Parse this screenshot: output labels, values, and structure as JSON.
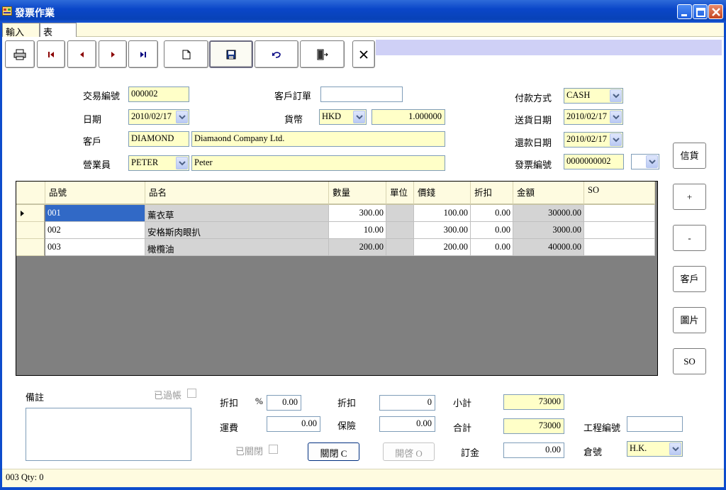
{
  "window": {
    "title": "發票作業"
  },
  "tabs": [
    {
      "label": "輸入"
    },
    {
      "label": "表"
    }
  ],
  "toolbar": {
    "buttons": [
      {
        "icon": "print-icon"
      },
      {
        "icon": "first-record-icon"
      },
      {
        "icon": "previous-record-icon"
      },
      {
        "icon": "next-record-icon"
      },
      {
        "icon": "last-record-icon"
      },
      {
        "icon": "new-document-icon"
      },
      {
        "icon": "save-icon"
      },
      {
        "icon": "undo-icon"
      },
      {
        "icon": "exit-door-icon"
      },
      {
        "icon": "close-x-icon"
      }
    ]
  },
  "form": {
    "trans_no_label": "交易編號",
    "trans_no": "000002",
    "date_label": "日期",
    "date": "2010/02/17",
    "customer_label": "客戶",
    "customer_code": "DIAMOND",
    "customer_name": "Diamaond Company Ltd.",
    "sales_label": "營業員",
    "sales_code": "PETER",
    "sales_name": "Peter",
    "po_label": "客戶訂單",
    "po": "",
    "currency_label": "貨幣",
    "currency": "HKD",
    "rate": "1.000000",
    "payment_label": "付款方式",
    "payment": "CASH",
    "delivery_label": "送貨日期",
    "delivery_date": "2010/02/17",
    "due_label": "還款日期",
    "due_date": "2010/02/17",
    "invoice_label": "發票編號",
    "invoice_no": "0000000002",
    "invoice_extra": ""
  },
  "side_buttons": [
    "信貨",
    "+",
    "-",
    "客戶",
    "圖片",
    "SO"
  ],
  "grid": {
    "columns": [
      "品號",
      "品名",
      "數量",
      "單位",
      "價錢",
      "折扣",
      "金額",
      "SO"
    ],
    "rows": [
      {
        "code": "001",
        "name": "薰衣草",
        "qty": "300.00",
        "unit": "",
        "price": "100.00",
        "disc": "0.00",
        "amount": "30000.00",
        "so": ""
      },
      {
        "code": "002",
        "name": "安格斯肉眼扒",
        "qty": "10.00",
        "unit": "",
        "price": "300.00",
        "disc": "0.00",
        "amount": "3000.00",
        "so": ""
      },
      {
        "code": "003",
        "name": "橄欖油",
        "qty": "200.00",
        "unit": "",
        "price": "200.00",
        "disc": "0.00",
        "amount": "40000.00",
        "so": ""
      }
    ]
  },
  "bottom": {
    "remark_label": "備註",
    "posted_label": "已過帳",
    "disc_label": "折扣",
    "pct_label": "%",
    "disc_pct": "0.00",
    "disc2_label": "折扣",
    "disc_amount": "0",
    "subtotal_label": "小計",
    "subtotal": "73000",
    "freight_label": "運費",
    "freight": "0.00",
    "insurance_label": "保險",
    "insurance": "0.00",
    "total_label": "合計",
    "total": "73000",
    "project_label": "工程編號",
    "project": "",
    "closed_label": "已關閉",
    "close_button": "關閉 C",
    "open_button": "開啓 O",
    "deposit_label": "訂金",
    "deposit": "0.00",
    "warehouse_label": "倉號",
    "warehouse": "H.K."
  },
  "status": {
    "text": "003  Qty: 0"
  }
}
